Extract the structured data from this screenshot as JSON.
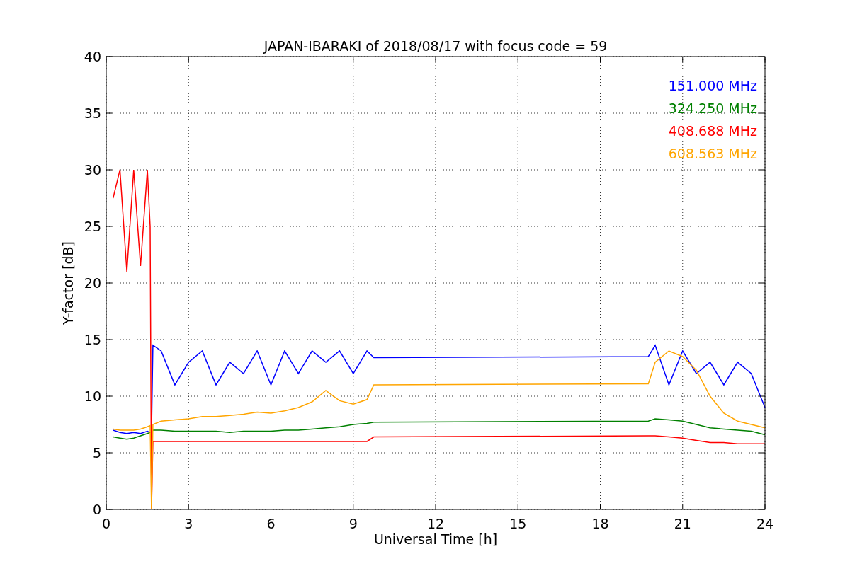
{
  "chart_data": {
    "type": "line",
    "title": "JAPAN-IBARAKI of 2018/08/17 with focus code = 59",
    "xlabel": "Universal Time [h]",
    "ylabel": "Y-factor [dB]",
    "x": [
      0.25,
      0.5,
      0.75,
      1,
      1.25,
      1.5,
      1.6,
      1.65,
      1.7,
      2,
      2.5,
      3,
      3.5,
      4,
      4.5,
      5,
      5.5,
      6,
      6.5,
      7,
      7.5,
      8,
      8.5,
      9,
      9.5,
      9.75,
      19.75,
      20,
      20.5,
      21,
      21.5,
      22,
      22.5,
      23,
      23.5,
      24
    ],
    "series": [
      {
        "name": "151.000 MHz",
        "color": "#0000ff",
        "values": [
          7.0,
          6.8,
          6.7,
          6.8,
          6.7,
          6.9,
          6.8,
          6.8,
          14.5,
          14,
          11,
          13,
          14,
          11,
          13,
          12,
          14,
          11,
          14,
          12,
          14,
          13,
          14,
          12,
          14,
          13.4,
          13.5,
          14.5,
          11,
          14,
          12,
          13,
          11,
          13,
          12,
          9
        ]
      },
      {
        "name": "324.250 MHz",
        "color": "#008000",
        "values": [
          6.4,
          6.3,
          6.2,
          6.3,
          6.5,
          6.7,
          6.8,
          6.8,
          7.0,
          7.0,
          6.9,
          6.9,
          6.9,
          6.9,
          6.8,
          6.9,
          6.9,
          6.9,
          7.0,
          7.0,
          7.1,
          7.2,
          7.3,
          7.5,
          7.6,
          7.7,
          7.8,
          8.0,
          7.9,
          7.8,
          7.5,
          7.2,
          7.1,
          7.0,
          6.9,
          6.6
        ]
      },
      {
        "name": "408.688 MHz",
        "color": "#ff0000",
        "values": [
          27.5,
          30,
          21,
          30,
          21.5,
          30,
          25,
          0,
          6,
          6,
          6,
          6,
          6,
          6,
          6,
          6,
          6,
          6,
          6,
          6,
          6,
          6,
          6,
          6,
          6,
          6.4,
          6.5,
          6.5,
          6.4,
          6.3,
          6.1,
          5.9,
          5.9,
          5.8,
          5.8,
          5.8
        ]
      },
      {
        "name": "608.563 MHz",
        "color": "#ffa500",
        "values": [
          7.1,
          7.0,
          7.0,
          7.0,
          7.1,
          7.3,
          7.4,
          0,
          7.5,
          7.8,
          7.9,
          8.0,
          8.2,
          8.2,
          8.3,
          8.4,
          8.6,
          8.5,
          8.7,
          9.0,
          9.5,
          10.5,
          9.6,
          9.3,
          9.7,
          11,
          11.1,
          13,
          14,
          13.5,
          12.3,
          10,
          8.5,
          7.8,
          7.5,
          7.2
        ]
      }
    ],
    "xlim": [
      0,
      24
    ],
    "ylim": [
      0,
      40
    ],
    "xticks": [
      0,
      3,
      6,
      9,
      12,
      15,
      18,
      21,
      24
    ],
    "yticks": [
      0,
      5,
      10,
      15,
      20,
      25,
      30,
      35,
      40
    ],
    "grid": true
  }
}
